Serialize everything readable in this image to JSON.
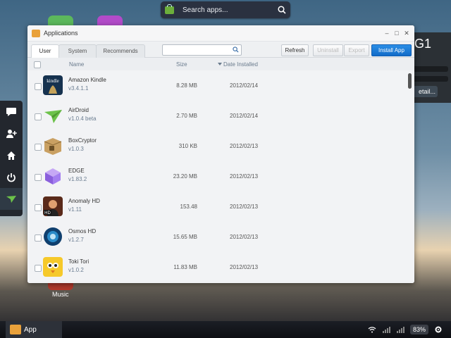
{
  "desktop": {
    "search_placeholder": "Search apps...",
    "widget_text": "G1",
    "widget_button": "etail...",
    "music_label": "Music"
  },
  "taskbar": {
    "app_label": "App",
    "battery": "83%"
  },
  "window": {
    "title": "Applications",
    "controls": {
      "minimize": "–",
      "maximize": "□",
      "close": "✕"
    },
    "tabs": [
      {
        "label": "User",
        "active": true
      },
      {
        "label": "System",
        "active": false
      },
      {
        "label": "Recommends",
        "active": false
      }
    ],
    "search_value": "",
    "buttons": {
      "refresh": "Refresh",
      "uninstall": "Uninstall",
      "export": "Export",
      "install": "Install App"
    },
    "columns": {
      "name": "Name",
      "size": "Size",
      "date": "Date Installed"
    },
    "apps": [
      {
        "name": "Amazon Kindle",
        "version": "v3.4.1.1",
        "size": "8.28 MB",
        "date": "2012/02/14",
        "icon": "kindle-icon"
      },
      {
        "name": "AirDroid",
        "version": "v1.0.4 beta",
        "size": "2.70 MB",
        "date": "2012/02/14",
        "icon": "airdroid-icon"
      },
      {
        "name": "BoxCryptor",
        "version": "v1.0.3",
        "size": "310 KB",
        "date": "2012/02/13",
        "icon": "boxcryptor-icon"
      },
      {
        "name": "EDGE",
        "version": "v1.83.2",
        "size": "23.20 MB",
        "date": "2012/02/13",
        "icon": "edge-cube-icon"
      },
      {
        "name": "Anomaly HD",
        "version": "v1.11",
        "size": "153.48",
        "date": "2012/02/13",
        "icon": "anomaly-hd-icon"
      },
      {
        "name": "Osmos HD",
        "version": "v1.2.7",
        "size": "15.65 MB",
        "date": "2012/02/13",
        "icon": "osmos-icon"
      },
      {
        "name": "Toki Tori",
        "version": "v1.0.2",
        "size": "11.83 MB",
        "date": "2012/02/13",
        "icon": "toki-tori-icon"
      }
    ]
  },
  "colors": {
    "primary_button": "#1a7bd8",
    "dock": "#23272e",
    "window_bg": "#f2f3f5"
  }
}
